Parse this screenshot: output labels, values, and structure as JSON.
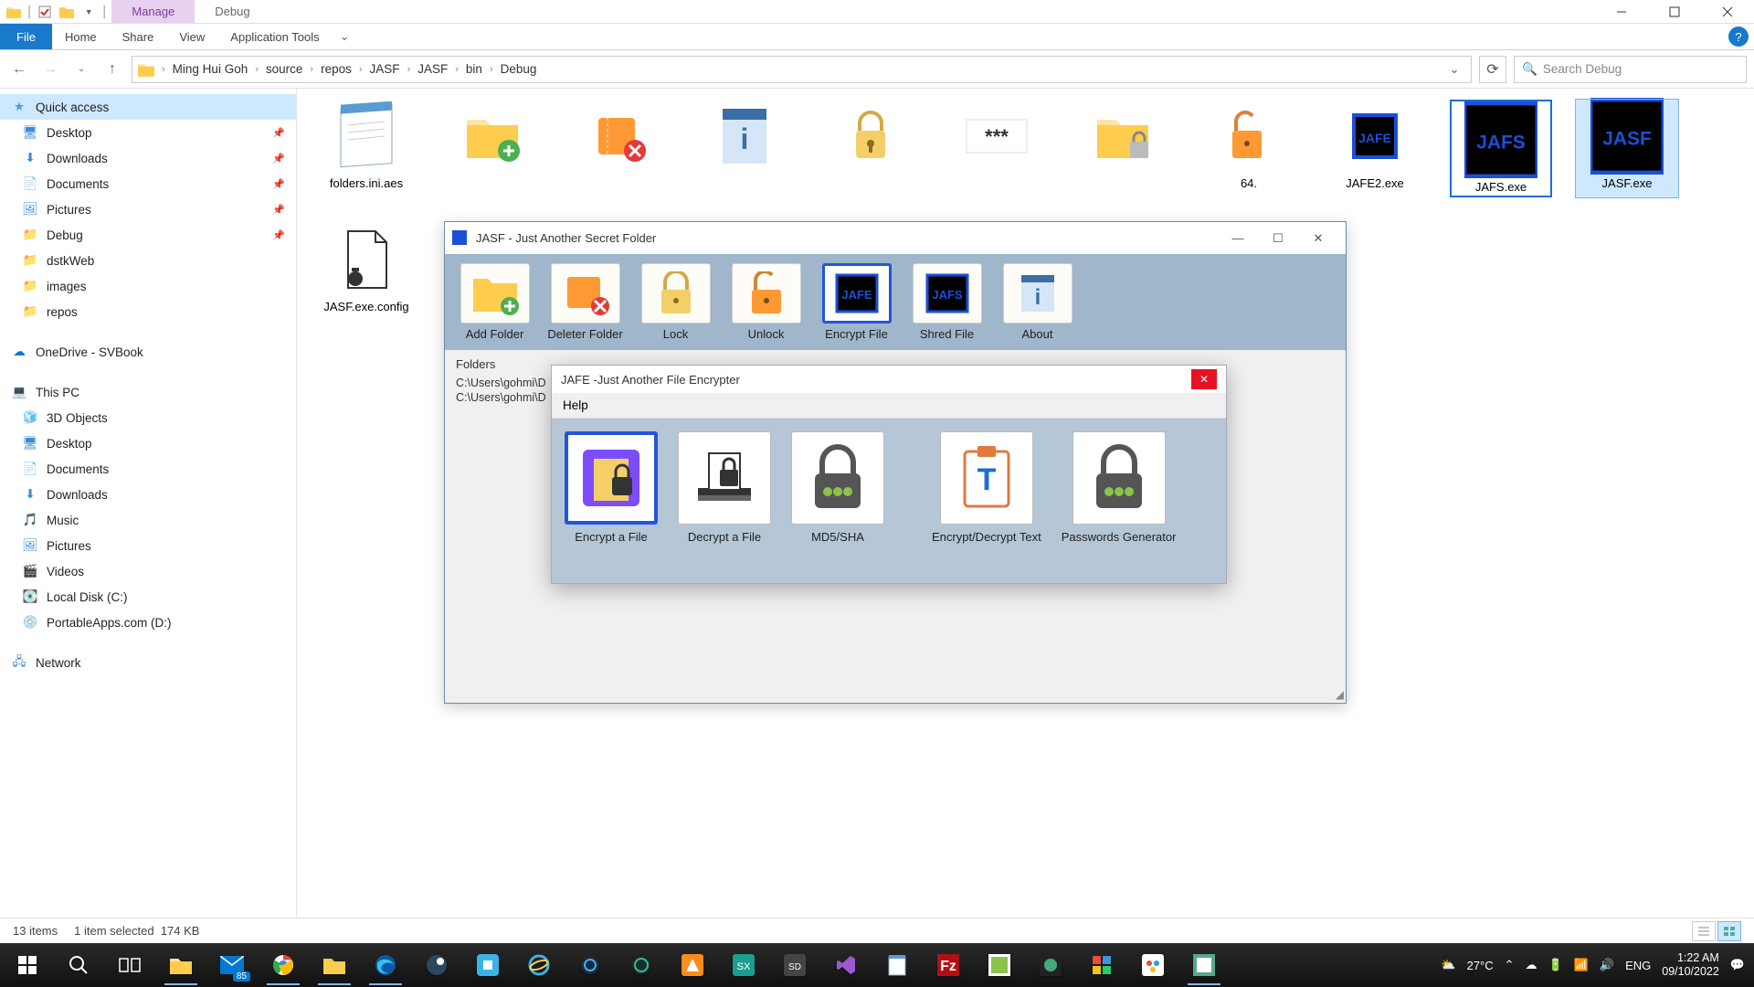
{
  "titlebar": {
    "contextual_manage": "Manage",
    "contextual_debug": "Debug"
  },
  "ribbon": {
    "file": "File",
    "tabs": [
      "Home",
      "Share",
      "View",
      "Application Tools"
    ]
  },
  "nav": {
    "breadcrumbs": [
      "Ming Hui Goh",
      "source",
      "repos",
      "JASF",
      "JASF",
      "bin",
      "Debug"
    ],
    "search_placeholder": "Search Debug"
  },
  "sidebar": {
    "quick_access": {
      "label": "Quick access",
      "items": [
        {
          "label": "Desktop",
          "pinned": true
        },
        {
          "label": "Downloads",
          "pinned": true
        },
        {
          "label": "Documents",
          "pinned": true
        },
        {
          "label": "Pictures",
          "pinned": true
        },
        {
          "label": "Debug",
          "pinned": true
        },
        {
          "label": "dstkWeb",
          "pinned": false
        },
        {
          "label": "images",
          "pinned": false
        },
        {
          "label": "repos",
          "pinned": false
        }
      ]
    },
    "onedrive": "OneDrive - SVBook",
    "this_pc": {
      "label": "This PC",
      "items": [
        "3D Objects",
        "Desktop",
        "Documents",
        "Downloads",
        "Music",
        "Pictures",
        "Videos",
        "Local Disk (C:)",
        "PortableApps.com (D:)"
      ]
    },
    "network": "Network"
  },
  "files": {
    "row1": [
      "folders.ini.aes",
      "",
      "",
      "",
      "",
      "",
      "",
      "64.",
      "JAFE2.exe",
      "JAFS.exe",
      "JASF.exe"
    ],
    "row2": [
      "JASF.exe.config"
    ]
  },
  "jasf": {
    "title": "JASF - Just Another Secret Folder",
    "toolbar": [
      "Add Folder",
      "Deleter Folder",
      "Lock",
      "Unlock",
      "Encrypt File",
      "Shred File",
      "About"
    ],
    "folders_label": "Folders",
    "paths": [
      "C:\\Users\\gohmi\\D",
      "C:\\Users\\gohmi\\D"
    ]
  },
  "jafe": {
    "title": "JAFE -Just Another File Encrypter",
    "menu_help": "Help",
    "tools": [
      "Encrypt a File",
      "Decrypt a File",
      "MD5/SHA",
      "Encrypt/Decrypt Text",
      "Passwords Generator"
    ]
  },
  "statusbar": {
    "items": "13 items",
    "selected": "1 item selected",
    "size": "174 KB"
  },
  "systray": {
    "weather": "27°C",
    "lang": "ENG",
    "time": "1:22 AM",
    "date": "09/10/2022",
    "mail_badge": "85"
  }
}
